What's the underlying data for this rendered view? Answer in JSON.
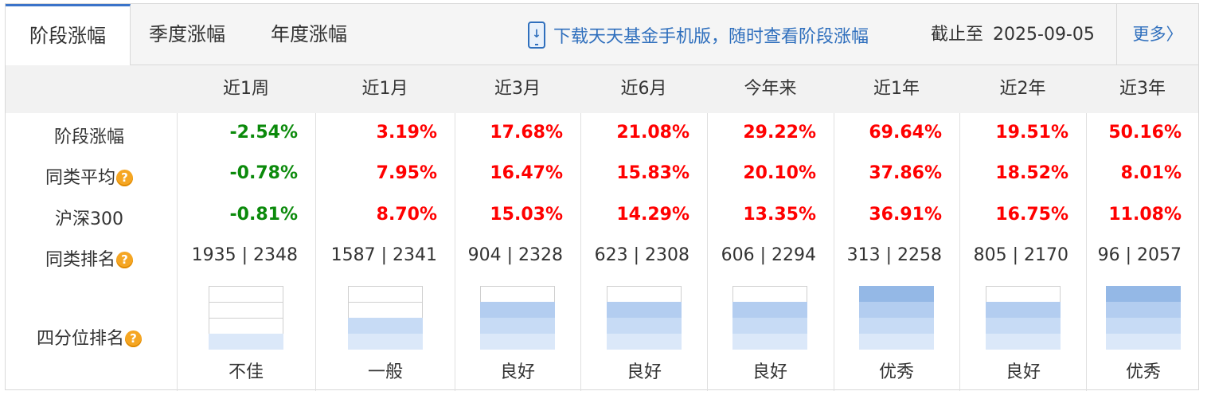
{
  "tabs": [
    {
      "label": "阶段涨幅",
      "active": true
    },
    {
      "label": "季度涨幅",
      "active": false
    },
    {
      "label": "年度涨幅",
      "active": false
    }
  ],
  "download_text": "下载天天基金手机版，随时查看阶段涨幅",
  "deadline_label": "截止至",
  "deadline_date": "2025-09-05",
  "more_label": "更多",
  "more_arrow": "〉",
  "help_mark": "?",
  "columns": [
    "近1周",
    "近1月",
    "近3月",
    "近6月",
    "今年来",
    "近1年",
    "近2年",
    "近3年"
  ],
  "rows": [
    {
      "label": "阶段涨幅",
      "help": false,
      "values": [
        "-2.54%",
        "3.19%",
        "17.68%",
        "21.08%",
        "29.22%",
        "69.64%",
        "19.51%",
        "50.16%"
      ]
    },
    {
      "label": "同类平均",
      "help": true,
      "values": [
        "-0.78%",
        "7.95%",
        "16.47%",
        "15.83%",
        "20.10%",
        "37.86%",
        "18.52%",
        "8.01%"
      ]
    },
    {
      "label": "沪深300",
      "help": false,
      "values": [
        "-0.81%",
        "8.70%",
        "15.03%",
        "14.29%",
        "13.35%",
        "36.91%",
        "16.75%",
        "11.08%"
      ]
    }
  ],
  "rank_row": {
    "label": "同类排名",
    "help": true,
    "values": [
      "1935 | 2348",
      "1587 | 2341",
      "904 | 2328",
      "623 | 2308",
      "606 | 2294",
      "313 | 2258",
      "805 | 2170",
      "96 | 2057"
    ]
  },
  "quartile_row": {
    "label": "四分位排名",
    "help": true,
    "levels": [
      1,
      2,
      3,
      3,
      3,
      4,
      3,
      4
    ],
    "labels": [
      "不佳",
      "一般",
      "良好",
      "良好",
      "良好",
      "优秀",
      "良好",
      "优秀"
    ]
  },
  "colors": {
    "positive": "#ff0000",
    "negative": "#0b8a0b",
    "quartile_fill": [
      "#dbe8f9",
      "#c7dbf5",
      "#b3cdf0",
      "#94b8e6"
    ],
    "link": "#2f6fbd"
  }
}
